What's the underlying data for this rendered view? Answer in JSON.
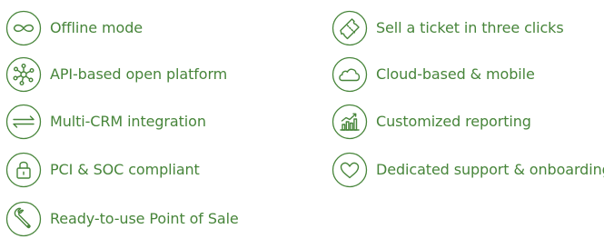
{
  "colors": {
    "accent": "#47853a"
  },
  "features": [
    {
      "label": "Offline mode",
      "icon": "infinity-icon"
    },
    {
      "label": "API-based open platform",
      "icon": "network-nodes-icon"
    },
    {
      "label": "Multi-CRM integration",
      "icon": "bidirectional-arrows-icon"
    },
    {
      "label": "PCI & SOC compliant",
      "icon": "padlock-icon"
    },
    {
      "label": "Ready-to-use Point of Sale",
      "icon": "wrench-icon"
    },
    {
      "label": "Sell a ticket in three clicks",
      "icon": "ticket-icon"
    },
    {
      "label": "Cloud-based & mobile",
      "icon": "cloud-icon"
    },
    {
      "label": "Customized reporting",
      "icon": "bar-chart-trend-icon"
    },
    {
      "label": "Dedicated support & onboarding",
      "icon": "heart-icon"
    }
  ]
}
